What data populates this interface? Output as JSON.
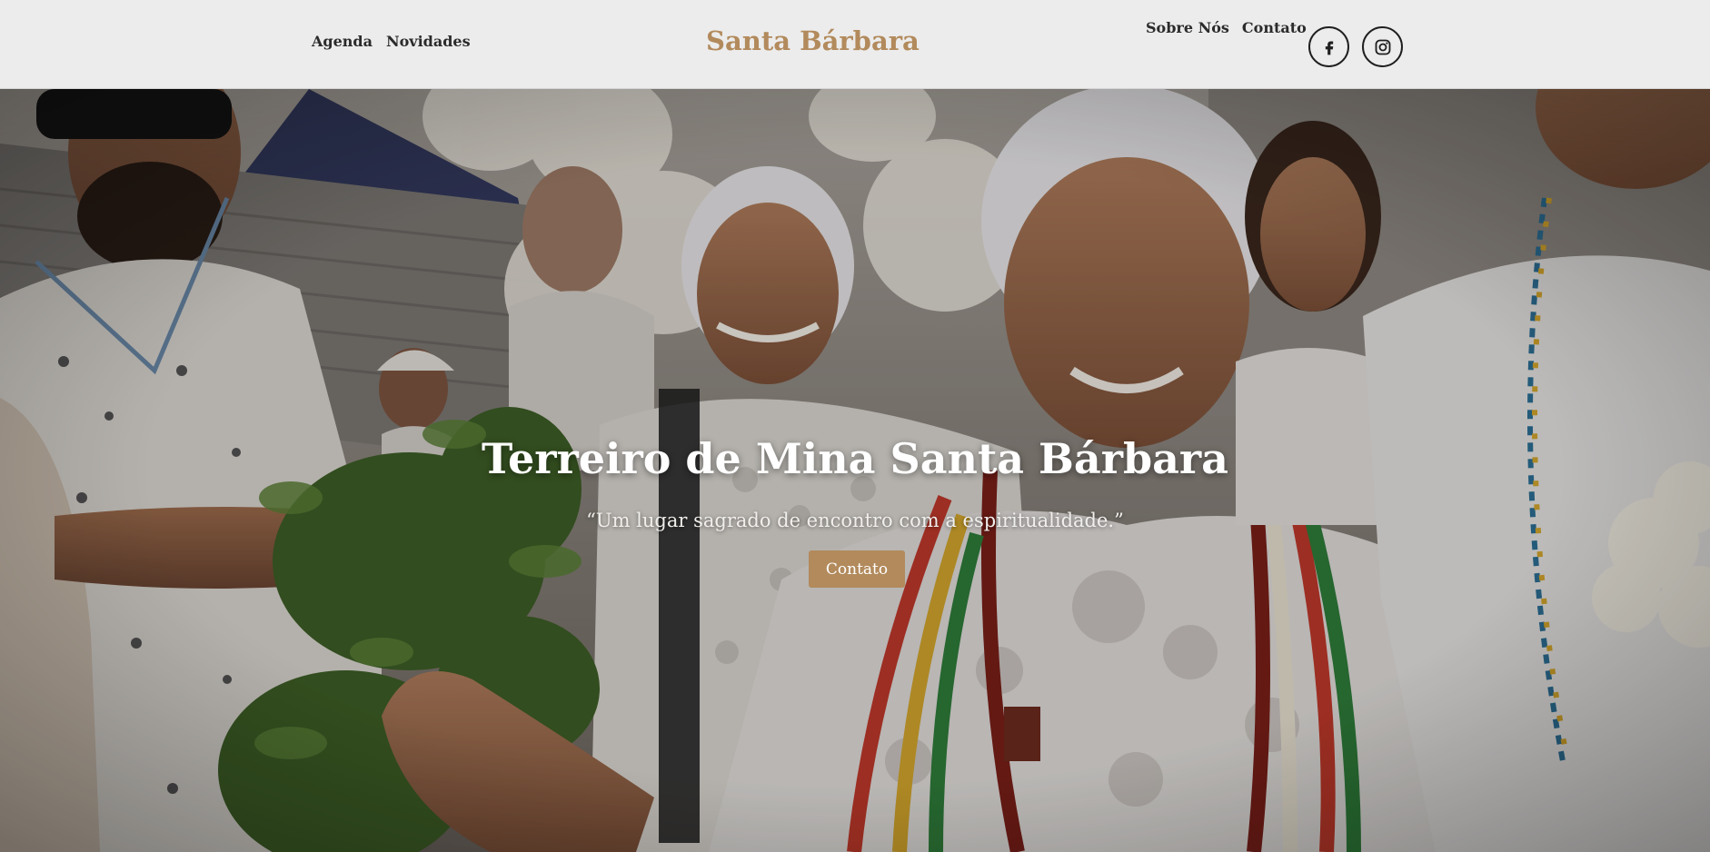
{
  "header": {
    "nav_left": [
      "Agenda",
      "Novidades"
    ],
    "brand": "Santa Bárbara",
    "nav_right": [
      "Sobre Nós",
      "Contato"
    ],
    "social": [
      {
        "icon": "facebook-icon"
      },
      {
        "icon": "instagram-icon"
      }
    ]
  },
  "hero": {
    "title": "Terreiro de Mina Santa Bárbara",
    "quote": "“Um lugar sagrado de encontro com a espiritualidade.”",
    "button_label": "Contato"
  },
  "colors": {
    "accent": "#b28a5c",
    "header_bg": "#ececec",
    "text_dark": "#2b2b2b"
  }
}
